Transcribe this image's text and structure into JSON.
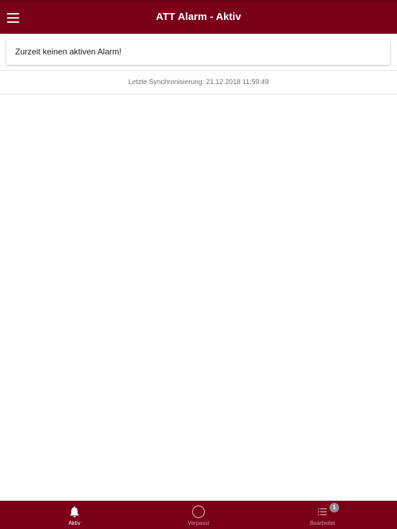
{
  "header": {
    "title": "ATT Alarm - Aktiv",
    "menu_icon": "hamburger-menu-icon",
    "background_color": "#7a0019"
  },
  "alarm_card": {
    "message": "Zurzeit keinen aktiven Alarm!"
  },
  "sync": {
    "text": "Letzte Synchronisierung: 21.12.2018 11:59:49"
  },
  "tabbar": {
    "background_color": "#7a0019",
    "tabs": [
      {
        "label": "Aktiv",
        "icon": "bell-icon",
        "active": true
      },
      {
        "label": "Verpasst",
        "icon": "circle-icon",
        "active": false
      },
      {
        "label": "Bearbeitet",
        "icon": "list-icon",
        "active": false,
        "badge": "1"
      }
    ]
  }
}
